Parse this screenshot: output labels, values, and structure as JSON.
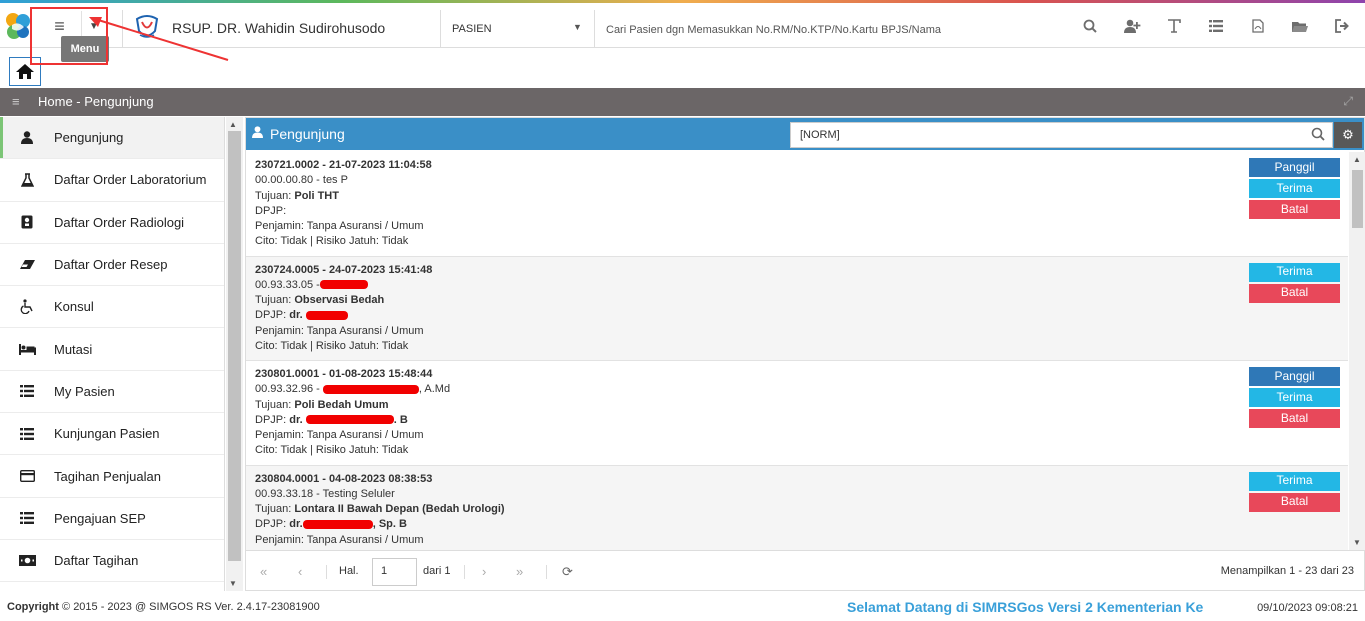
{
  "header": {
    "tooltip": "Menu",
    "hospital_name": "RSUP. DR. Wahidin Sudirohusodo",
    "search_type": "PASIEN",
    "search_hint": "Cari Pasien dgn Memasukkan No.RM/No.KTP/No.Kartu BPJS/Nama",
    "icons": [
      "search-icon",
      "add-user-icon",
      "text-icon",
      "list-icon",
      "pdf-icon",
      "folder-icon",
      "logout-icon"
    ]
  },
  "breadcrumb": {
    "text": "Home - Pengunjung"
  },
  "sidebar": {
    "items": [
      {
        "label": "Pengunjung",
        "icon": "user-icon"
      },
      {
        "label": "Daftar Order Laboratorium",
        "icon": "flask-icon"
      },
      {
        "label": "Daftar Order Radiologi",
        "icon": "radiology-icon"
      },
      {
        "label": "Daftar Order Resep",
        "icon": "eraser-icon"
      },
      {
        "label": "Konsul",
        "icon": "wheelchair-icon"
      },
      {
        "label": "Mutasi",
        "icon": "bed-icon"
      },
      {
        "label": "My Pasien",
        "icon": "list-icon"
      },
      {
        "label": "Kunjungan Pasien",
        "icon": "list-icon"
      },
      {
        "label": "Tagihan Penjualan",
        "icon": "credit-card-icon"
      },
      {
        "label": "Pengajuan SEP",
        "icon": "list-icon"
      },
      {
        "label": "Daftar Tagihan",
        "icon": "money-icon"
      }
    ]
  },
  "panel": {
    "title": "Pengunjung",
    "filter_value": "[NORM]",
    "entries": [
      {
        "id_line": "230721.0002 - 21-07-2023 11:04:58",
        "patient": "00.00.00.80 - tes P",
        "tujuan_label": "Tujuan:",
        "tujuan": "Poli THT",
        "dpjp_label": "DPJP:",
        "dpjp": "",
        "penjamin": "Penjamin: Tanpa Asuransi / Umum",
        "cito": "Cito: Tidak | Risiko Jatuh: Tidak",
        "buttons": [
          "Panggil",
          "Terima",
          "Batal"
        ]
      },
      {
        "id_line": "230724.0005 - 24-07-2023 15:41:48",
        "patient": "00.93.33.05 -",
        "tujuan_label": "Tujuan:",
        "tujuan": "Observasi Bedah",
        "dpjp_label": "DPJP:",
        "dpjp": "dr.",
        "penjamin": "Penjamin: Tanpa Asuransi / Umum",
        "cito": "Cito: Tidak | Risiko Jatuh: Tidak",
        "buttons": [
          "Terima",
          "Batal"
        ]
      },
      {
        "id_line": "230801.0001 - 01-08-2023 15:48:44",
        "patient": "00.93.32.96 -",
        "patient_suffix": ", A.Md",
        "tujuan_label": "Tujuan:",
        "tujuan": "Poli Bedah Umum",
        "dpjp_label": "DPJP:",
        "dpjp": "dr.",
        "dpjp_suffix": ". B",
        "penjamin": "Penjamin: Tanpa Asuransi / Umum",
        "cito": "Cito: Tidak | Risiko Jatuh: Tidak",
        "buttons": [
          "Panggil",
          "Terima",
          "Batal"
        ]
      },
      {
        "id_line": "230804.0001 - 04-08-2023 08:38:53",
        "patient": "00.93.33.18 - Testing Seluler",
        "tujuan_label": "Tujuan:",
        "tujuan": "Lontara II Bawah Depan (Bedah Urologi)",
        "dpjp_label": "DPJP:",
        "dpjp": "dr.",
        "dpjp_suffix": ", Sp. B",
        "penjamin": "Penjamin: Tanpa Asuransi / Umum",
        "buttons": [
          "Terima",
          "Batal"
        ]
      }
    ]
  },
  "pager": {
    "hal_label": "Hal.",
    "page": "1",
    "of_label": "dari 1",
    "summary": "Menampilkan 1 - 23 dari 23"
  },
  "footer": {
    "copyright_label": "Copyright",
    "copyright_text": "2015 - 2023 @ SIMGOS RS Ver. 2.4.17-23081900",
    "welcome": "Selamat Datang di SIMRSGos Versi 2 Kementerian Ke",
    "datetime": "09/10/2023 09:08:21"
  }
}
